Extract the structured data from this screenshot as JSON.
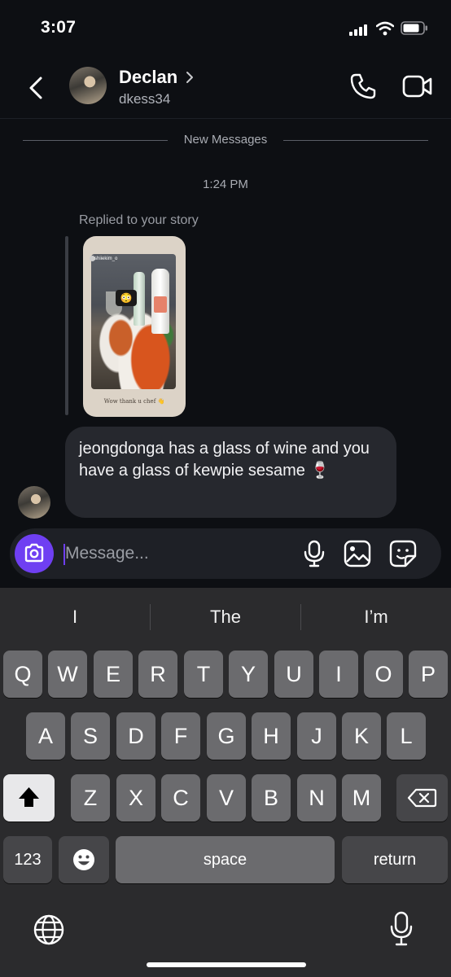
{
  "status_bar": {
    "time": "3:07"
  },
  "header": {
    "contact_name": "Declan",
    "contact_handle": "dkess34",
    "icons": [
      "back-icon",
      "chevron-right-icon",
      "phone-icon",
      "video-camera-icon"
    ]
  },
  "thread": {
    "divider_label": "New Messages",
    "timestamp": "1:24 PM",
    "replied_label": "Replied to your story",
    "story": {
      "username": "shiiekim_o",
      "caption": "Wow thank u chef 👋"
    },
    "message_text": "jeongdonga has a glass of wine and you have a glass of kewpie sesame 🍷"
  },
  "composer": {
    "placeholder": "Message...",
    "icons": [
      "camera-icon",
      "microphone-icon",
      "gallery-icon",
      "sticker-icon"
    ]
  },
  "keyboard": {
    "suggestions": [
      "I",
      "The",
      "I’m"
    ],
    "row1": [
      "Q",
      "W",
      "E",
      "R",
      "T",
      "Y",
      "U",
      "I",
      "O",
      "P"
    ],
    "row2": [
      "A",
      "S",
      "D",
      "F",
      "G",
      "H",
      "J",
      "K",
      "L"
    ],
    "row3": [
      "Z",
      "X",
      "C",
      "V",
      "B",
      "N",
      "M"
    ],
    "numbers_label": "123",
    "space_label": "space",
    "return_label": "return",
    "icons": [
      "shift-icon",
      "delete-icon",
      "emoji-icon",
      "globe-icon",
      "dictation-icon"
    ]
  },
  "colors": {
    "accent": "#6f3ff2",
    "background": "#0d0f13",
    "bubble": "#26282e",
    "keyboard": "#2b2b2d"
  }
}
